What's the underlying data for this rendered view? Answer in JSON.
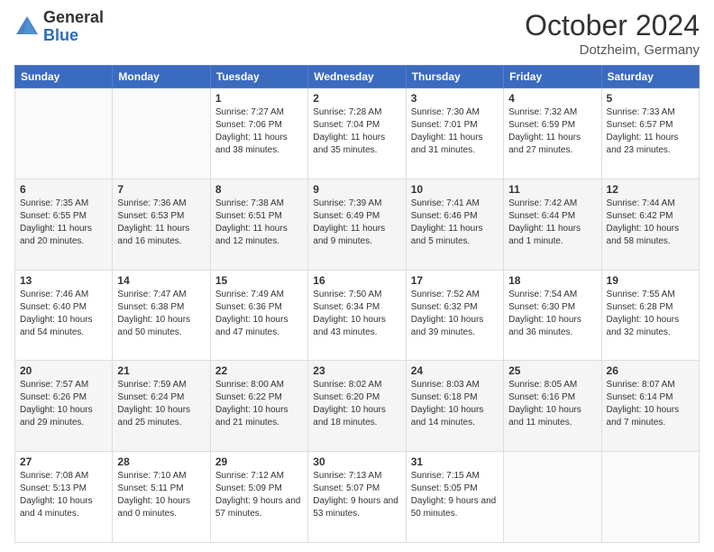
{
  "header": {
    "logo_general": "General",
    "logo_blue": "Blue",
    "title": "October 2024",
    "location": "Dotzheim, Germany"
  },
  "weekdays": [
    "Sunday",
    "Monday",
    "Tuesday",
    "Wednesday",
    "Thursday",
    "Friday",
    "Saturday"
  ],
  "weeks": [
    [
      {
        "day": "",
        "detail": ""
      },
      {
        "day": "",
        "detail": ""
      },
      {
        "day": "1",
        "detail": "Sunrise: 7:27 AM\nSunset: 7:06 PM\nDaylight: 11 hours and 38 minutes."
      },
      {
        "day": "2",
        "detail": "Sunrise: 7:28 AM\nSunset: 7:04 PM\nDaylight: 11 hours and 35 minutes."
      },
      {
        "day": "3",
        "detail": "Sunrise: 7:30 AM\nSunset: 7:01 PM\nDaylight: 11 hours and 31 minutes."
      },
      {
        "day": "4",
        "detail": "Sunrise: 7:32 AM\nSunset: 6:59 PM\nDaylight: 11 hours and 27 minutes."
      },
      {
        "day": "5",
        "detail": "Sunrise: 7:33 AM\nSunset: 6:57 PM\nDaylight: 11 hours and 23 minutes."
      }
    ],
    [
      {
        "day": "6",
        "detail": "Sunrise: 7:35 AM\nSunset: 6:55 PM\nDaylight: 11 hours and 20 minutes."
      },
      {
        "day": "7",
        "detail": "Sunrise: 7:36 AM\nSunset: 6:53 PM\nDaylight: 11 hours and 16 minutes."
      },
      {
        "day": "8",
        "detail": "Sunrise: 7:38 AM\nSunset: 6:51 PM\nDaylight: 11 hours and 12 minutes."
      },
      {
        "day": "9",
        "detail": "Sunrise: 7:39 AM\nSunset: 6:49 PM\nDaylight: 11 hours and 9 minutes."
      },
      {
        "day": "10",
        "detail": "Sunrise: 7:41 AM\nSunset: 6:46 PM\nDaylight: 11 hours and 5 minutes."
      },
      {
        "day": "11",
        "detail": "Sunrise: 7:42 AM\nSunset: 6:44 PM\nDaylight: 11 hours and 1 minute."
      },
      {
        "day": "12",
        "detail": "Sunrise: 7:44 AM\nSunset: 6:42 PM\nDaylight: 10 hours and 58 minutes."
      }
    ],
    [
      {
        "day": "13",
        "detail": "Sunrise: 7:46 AM\nSunset: 6:40 PM\nDaylight: 10 hours and 54 minutes."
      },
      {
        "day": "14",
        "detail": "Sunrise: 7:47 AM\nSunset: 6:38 PM\nDaylight: 10 hours and 50 minutes."
      },
      {
        "day": "15",
        "detail": "Sunrise: 7:49 AM\nSunset: 6:36 PM\nDaylight: 10 hours and 47 minutes."
      },
      {
        "day": "16",
        "detail": "Sunrise: 7:50 AM\nSunset: 6:34 PM\nDaylight: 10 hours and 43 minutes."
      },
      {
        "day": "17",
        "detail": "Sunrise: 7:52 AM\nSunset: 6:32 PM\nDaylight: 10 hours and 39 minutes."
      },
      {
        "day": "18",
        "detail": "Sunrise: 7:54 AM\nSunset: 6:30 PM\nDaylight: 10 hours and 36 minutes."
      },
      {
        "day": "19",
        "detail": "Sunrise: 7:55 AM\nSunset: 6:28 PM\nDaylight: 10 hours and 32 minutes."
      }
    ],
    [
      {
        "day": "20",
        "detail": "Sunrise: 7:57 AM\nSunset: 6:26 PM\nDaylight: 10 hours and 29 minutes."
      },
      {
        "day": "21",
        "detail": "Sunrise: 7:59 AM\nSunset: 6:24 PM\nDaylight: 10 hours and 25 minutes."
      },
      {
        "day": "22",
        "detail": "Sunrise: 8:00 AM\nSunset: 6:22 PM\nDaylight: 10 hours and 21 minutes."
      },
      {
        "day": "23",
        "detail": "Sunrise: 8:02 AM\nSunset: 6:20 PM\nDaylight: 10 hours and 18 minutes."
      },
      {
        "day": "24",
        "detail": "Sunrise: 8:03 AM\nSunset: 6:18 PM\nDaylight: 10 hours and 14 minutes."
      },
      {
        "day": "25",
        "detail": "Sunrise: 8:05 AM\nSunset: 6:16 PM\nDaylight: 10 hours and 11 minutes."
      },
      {
        "day": "26",
        "detail": "Sunrise: 8:07 AM\nSunset: 6:14 PM\nDaylight: 10 hours and 7 minutes."
      }
    ],
    [
      {
        "day": "27",
        "detail": "Sunrise: 7:08 AM\nSunset: 5:13 PM\nDaylight: 10 hours and 4 minutes."
      },
      {
        "day": "28",
        "detail": "Sunrise: 7:10 AM\nSunset: 5:11 PM\nDaylight: 10 hours and 0 minutes."
      },
      {
        "day": "29",
        "detail": "Sunrise: 7:12 AM\nSunset: 5:09 PM\nDaylight: 9 hours and 57 minutes."
      },
      {
        "day": "30",
        "detail": "Sunrise: 7:13 AM\nSunset: 5:07 PM\nDaylight: 9 hours and 53 minutes."
      },
      {
        "day": "31",
        "detail": "Sunrise: 7:15 AM\nSunset: 5:05 PM\nDaylight: 9 hours and 50 minutes."
      },
      {
        "day": "",
        "detail": ""
      },
      {
        "day": "",
        "detail": ""
      }
    ]
  ]
}
